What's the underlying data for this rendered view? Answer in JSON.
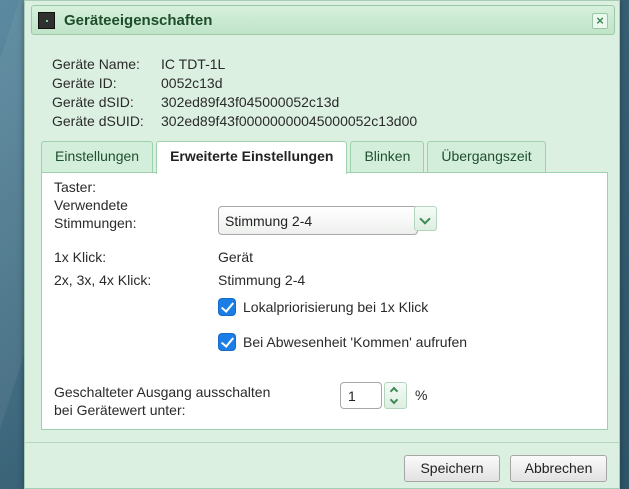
{
  "dialog": {
    "title": "Geräteeigenschaften",
    "close_symbol": "×"
  },
  "device_info": {
    "name_label": "Geräte Name:",
    "name_value": "IC TDT-1L",
    "id_label": "Geräte ID:",
    "id_value": "0052c13d",
    "dsid_label": "Geräte dSID:",
    "dsid_value": "302ed89f43f045000052c13d",
    "dsuid_label": "Geräte dSUID:",
    "dsuid_value": "302ed89f43f00000000045000052c13d00"
  },
  "tabs": [
    {
      "label": "Einstellungen",
      "active": false
    },
    {
      "label": "Erweiterte Einstellungen",
      "active": true
    },
    {
      "label": "Blinken",
      "active": false
    },
    {
      "label": "Übergangszeit",
      "active": false
    }
  ],
  "panel": {
    "taster_label": "Taster:",
    "stimmungen_label_line1": "Verwendete",
    "stimmungen_label_line2": "Stimmungen:",
    "stimmungen_value": "Stimmung 2-4",
    "klick1_label": "1x Klick:",
    "klick1_value": "Gerät",
    "klick234_label": "2x, 3x, 4x Klick:",
    "klick234_value": "Stimmung 2-4",
    "checkbox_local_label": "Lokalpriorisierung bei 1x Klick",
    "checkbox_local_checked": true,
    "checkbox_absent_label": "Bei Abwesenheit 'Kommen' aufrufen",
    "checkbox_absent_checked": true,
    "threshold_label_line1": "Geschalteter Ausgang ausschalten",
    "threshold_label_line2": "bei Gerätewert unter:",
    "threshold_value": "1",
    "threshold_unit": "%"
  },
  "buttons": {
    "save": "Speichern",
    "cancel": "Abbrechen"
  },
  "colors": {
    "accent": "#3e8a55",
    "checkbox": "#1a7ee6",
    "dialog_bg": "#dcf0e2"
  }
}
